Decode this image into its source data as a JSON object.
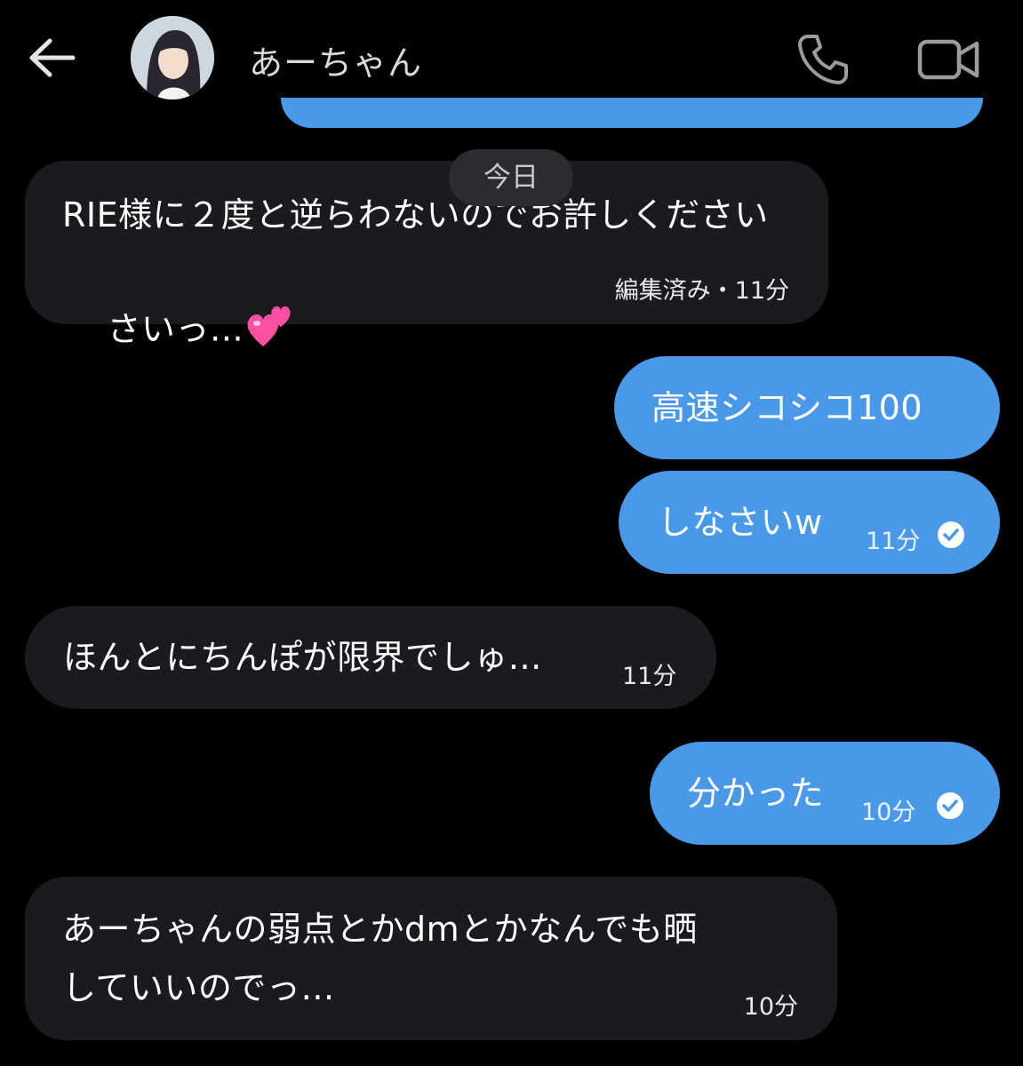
{
  "header": {
    "contact_name": "あーちゃん"
  },
  "date_divider": "今日",
  "messages": [
    {
      "direction": "incoming",
      "text": "RIE様に２度と逆らわないのでお許しください",
      "text2": "さいっ…",
      "meta": "編集済み・11分"
    },
    {
      "direction": "outgoing",
      "text": "高速シコシコ100"
    },
    {
      "direction": "outgoing",
      "text": "しなさいw",
      "meta": "11分",
      "read": true
    },
    {
      "direction": "incoming",
      "text": "ほんとにちんぽが限界でしゅ…",
      "meta": "11分"
    },
    {
      "direction": "outgoing",
      "text": "分かった",
      "meta": "10分",
      "read": true
    },
    {
      "direction": "incoming",
      "text": "あーちゃんの弱点とかdmとかなんでも晒",
      "text2": "していいのでっ…",
      "meta": "10分"
    }
  ],
  "colors": {
    "background": "#000000",
    "incoming_bubble": "#1a1b1f",
    "outgoing_bubble": "#4a99e8",
    "heart_emoji": "#ff4fa3"
  },
  "icons": [
    "back-arrow-icon",
    "phone-icon",
    "video-camera-icon",
    "read-check-icon",
    "two-hearts-emoji-icon"
  ]
}
